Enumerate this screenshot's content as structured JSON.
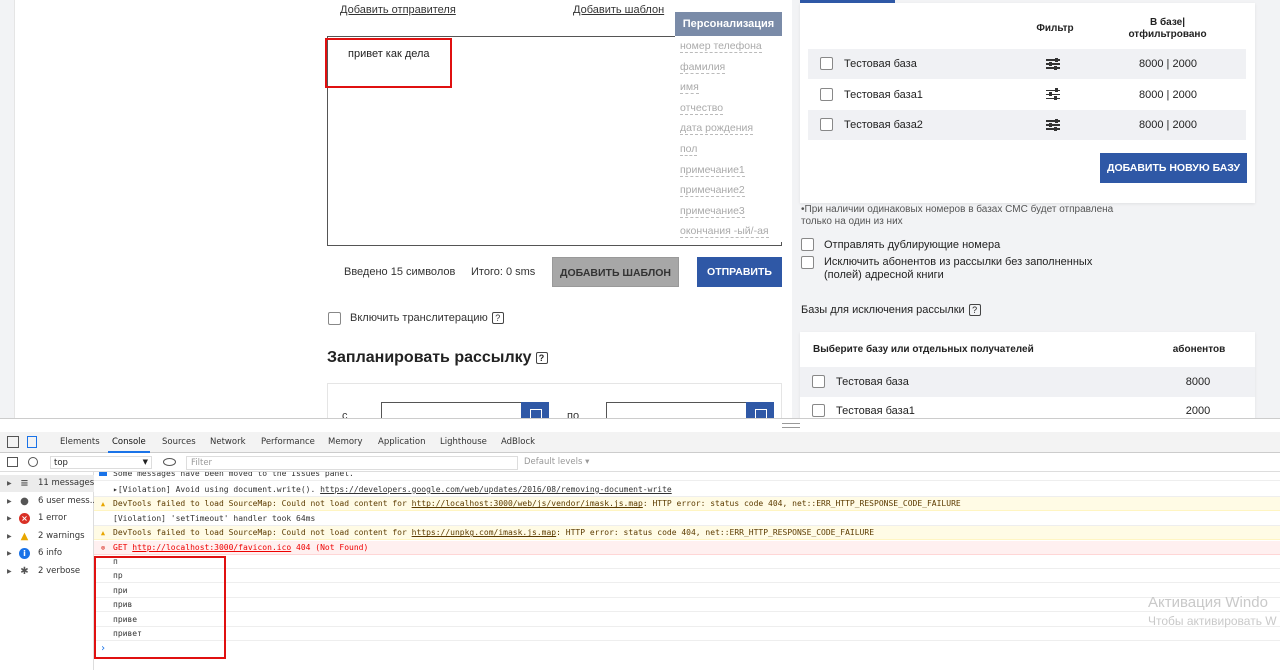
{
  "sms_form": {
    "add_sender_link": "Добавить отправителя",
    "add_template_link": "Добавить шаблон",
    "message_text": "привет как дела",
    "personalization": {
      "title": "Персонализация",
      "items": [
        "номер телефона",
        "фамилия",
        "имя",
        "отчество",
        "дата рождения",
        "пол",
        "примечание1",
        "примечание2",
        "примечание3",
        "окончания -ый/-ая"
      ]
    },
    "chars_entered": "Введено 15 символов",
    "total": "Итого: 0 sms",
    "add_template_button": "ДОБАВИТЬ ШАБЛОН",
    "send_button": "ОТПРАВИТЬ",
    "transliteration_label": "Включить транслитерацию",
    "schedule_title": "Запланировать рассылку",
    "help_glyph": "?",
    "date_from_label": "с",
    "date_to_label": "по"
  },
  "bases": {
    "col_filter": "Фильтр",
    "col_count_line1": "В базе|",
    "col_count_line2": "отфильтровано",
    "rows": [
      {
        "name": "Тестовая база",
        "value": "8000 | 2000"
      },
      {
        "name": "Тестовая база1",
        "value": "8000 | 2000"
      },
      {
        "name": "Тестовая база2",
        "value": "8000 | 2000"
      }
    ],
    "add_base_button": "ДОБАВИТЬ НОВУЮ БАЗУ",
    "note_line1": "•При наличии одинаковых номеров в базах СМС будет отправлена",
    "note_line2": "только на один из них",
    "option_duplicates": "Отправлять дублирующие номера",
    "option_exclude_line1": "Исключить абонентов из рассылки без заполненных",
    "option_exclude_line2": "(полей) адресной книги",
    "exclusion_title": "Базы для исключения рассылки",
    "exclusion_col_name": "Выберите базу или отдельных получателей",
    "exclusion_col_count": "абонентов",
    "exclusion_rows": [
      {
        "name": "Тестовая база",
        "value": "8000"
      },
      {
        "name": "Тестовая база1",
        "value": "2000"
      }
    ]
  },
  "devtools": {
    "tabs": [
      "Elements",
      "Console",
      "Sources",
      "Network",
      "Performance",
      "Memory",
      "Application",
      "Lighthouse",
      "AdBlock"
    ],
    "active_tab": "Console",
    "context": "top",
    "filter_placeholder": "Filter",
    "levels": "Default levels ▾",
    "sidebar": [
      {
        "label": "11 messages",
        "icon": "list-icon"
      },
      {
        "label": "6 user mess...",
        "icon": "user-icon"
      },
      {
        "label": "1 error",
        "icon": "error-icon"
      },
      {
        "label": "2 warnings",
        "icon": "warning-icon"
      },
      {
        "label": "6 info",
        "icon": "info-icon"
      },
      {
        "label": "2 verbose",
        "icon": "bug-icon"
      }
    ],
    "console_lines": [
      {
        "type": "info",
        "text": "Some messages have been moved to the Issues panel."
      },
      {
        "type": "log",
        "pre": "▸[Violation] Avoid using document.write(). ",
        "url": "https://developers.google.com/web/updates/2016/08/removing-document-write",
        "post": ""
      },
      {
        "type": "warn",
        "pre": "DevTools failed to load SourceMap: Could not load content for ",
        "url": "http://localhost:3000/web/js/vendor/imask.js.map",
        "post": ": HTTP error: status code 404, net::ERR_HTTP_RESPONSE_CODE_FAILURE"
      },
      {
        "type": "log",
        "pre": "[Violation] 'setTimeout' handler took 64ms",
        "url": "",
        "post": ""
      },
      {
        "type": "warn",
        "pre": "DevTools failed to load SourceMap: Could not load content for ",
        "url": "https://unpkg.com/imask.js.map",
        "post": ": HTTP error: status code 404, net::ERR_HTTP_RESPONSE_CODE_FAILURE"
      },
      {
        "type": "err",
        "pre": "GET ",
        "url": "http://localhost:3000/favicon.ico",
        "post": " 404 (Not Found)"
      },
      {
        "type": "log",
        "pre": "п",
        "url": "",
        "post": ""
      },
      {
        "type": "log",
        "pre": "пр",
        "url": "",
        "post": ""
      },
      {
        "type": "log",
        "pre": "при",
        "url": "",
        "post": ""
      },
      {
        "type": "log",
        "pre": "прив",
        "url": "",
        "post": ""
      },
      {
        "type": "log",
        "pre": "приве",
        "url": "",
        "post": ""
      },
      {
        "type": "log",
        "pre": "привет",
        "url": "",
        "post": ""
      }
    ],
    "prompt": "›"
  },
  "watermark": {
    "line1": "Активация Windo",
    "line2": "Чтобы активировать W"
  },
  "colors": {
    "accent_blue": "#2f58a6",
    "highlight_red": "#e01010",
    "personalization_header": "#7a8ba8"
  }
}
